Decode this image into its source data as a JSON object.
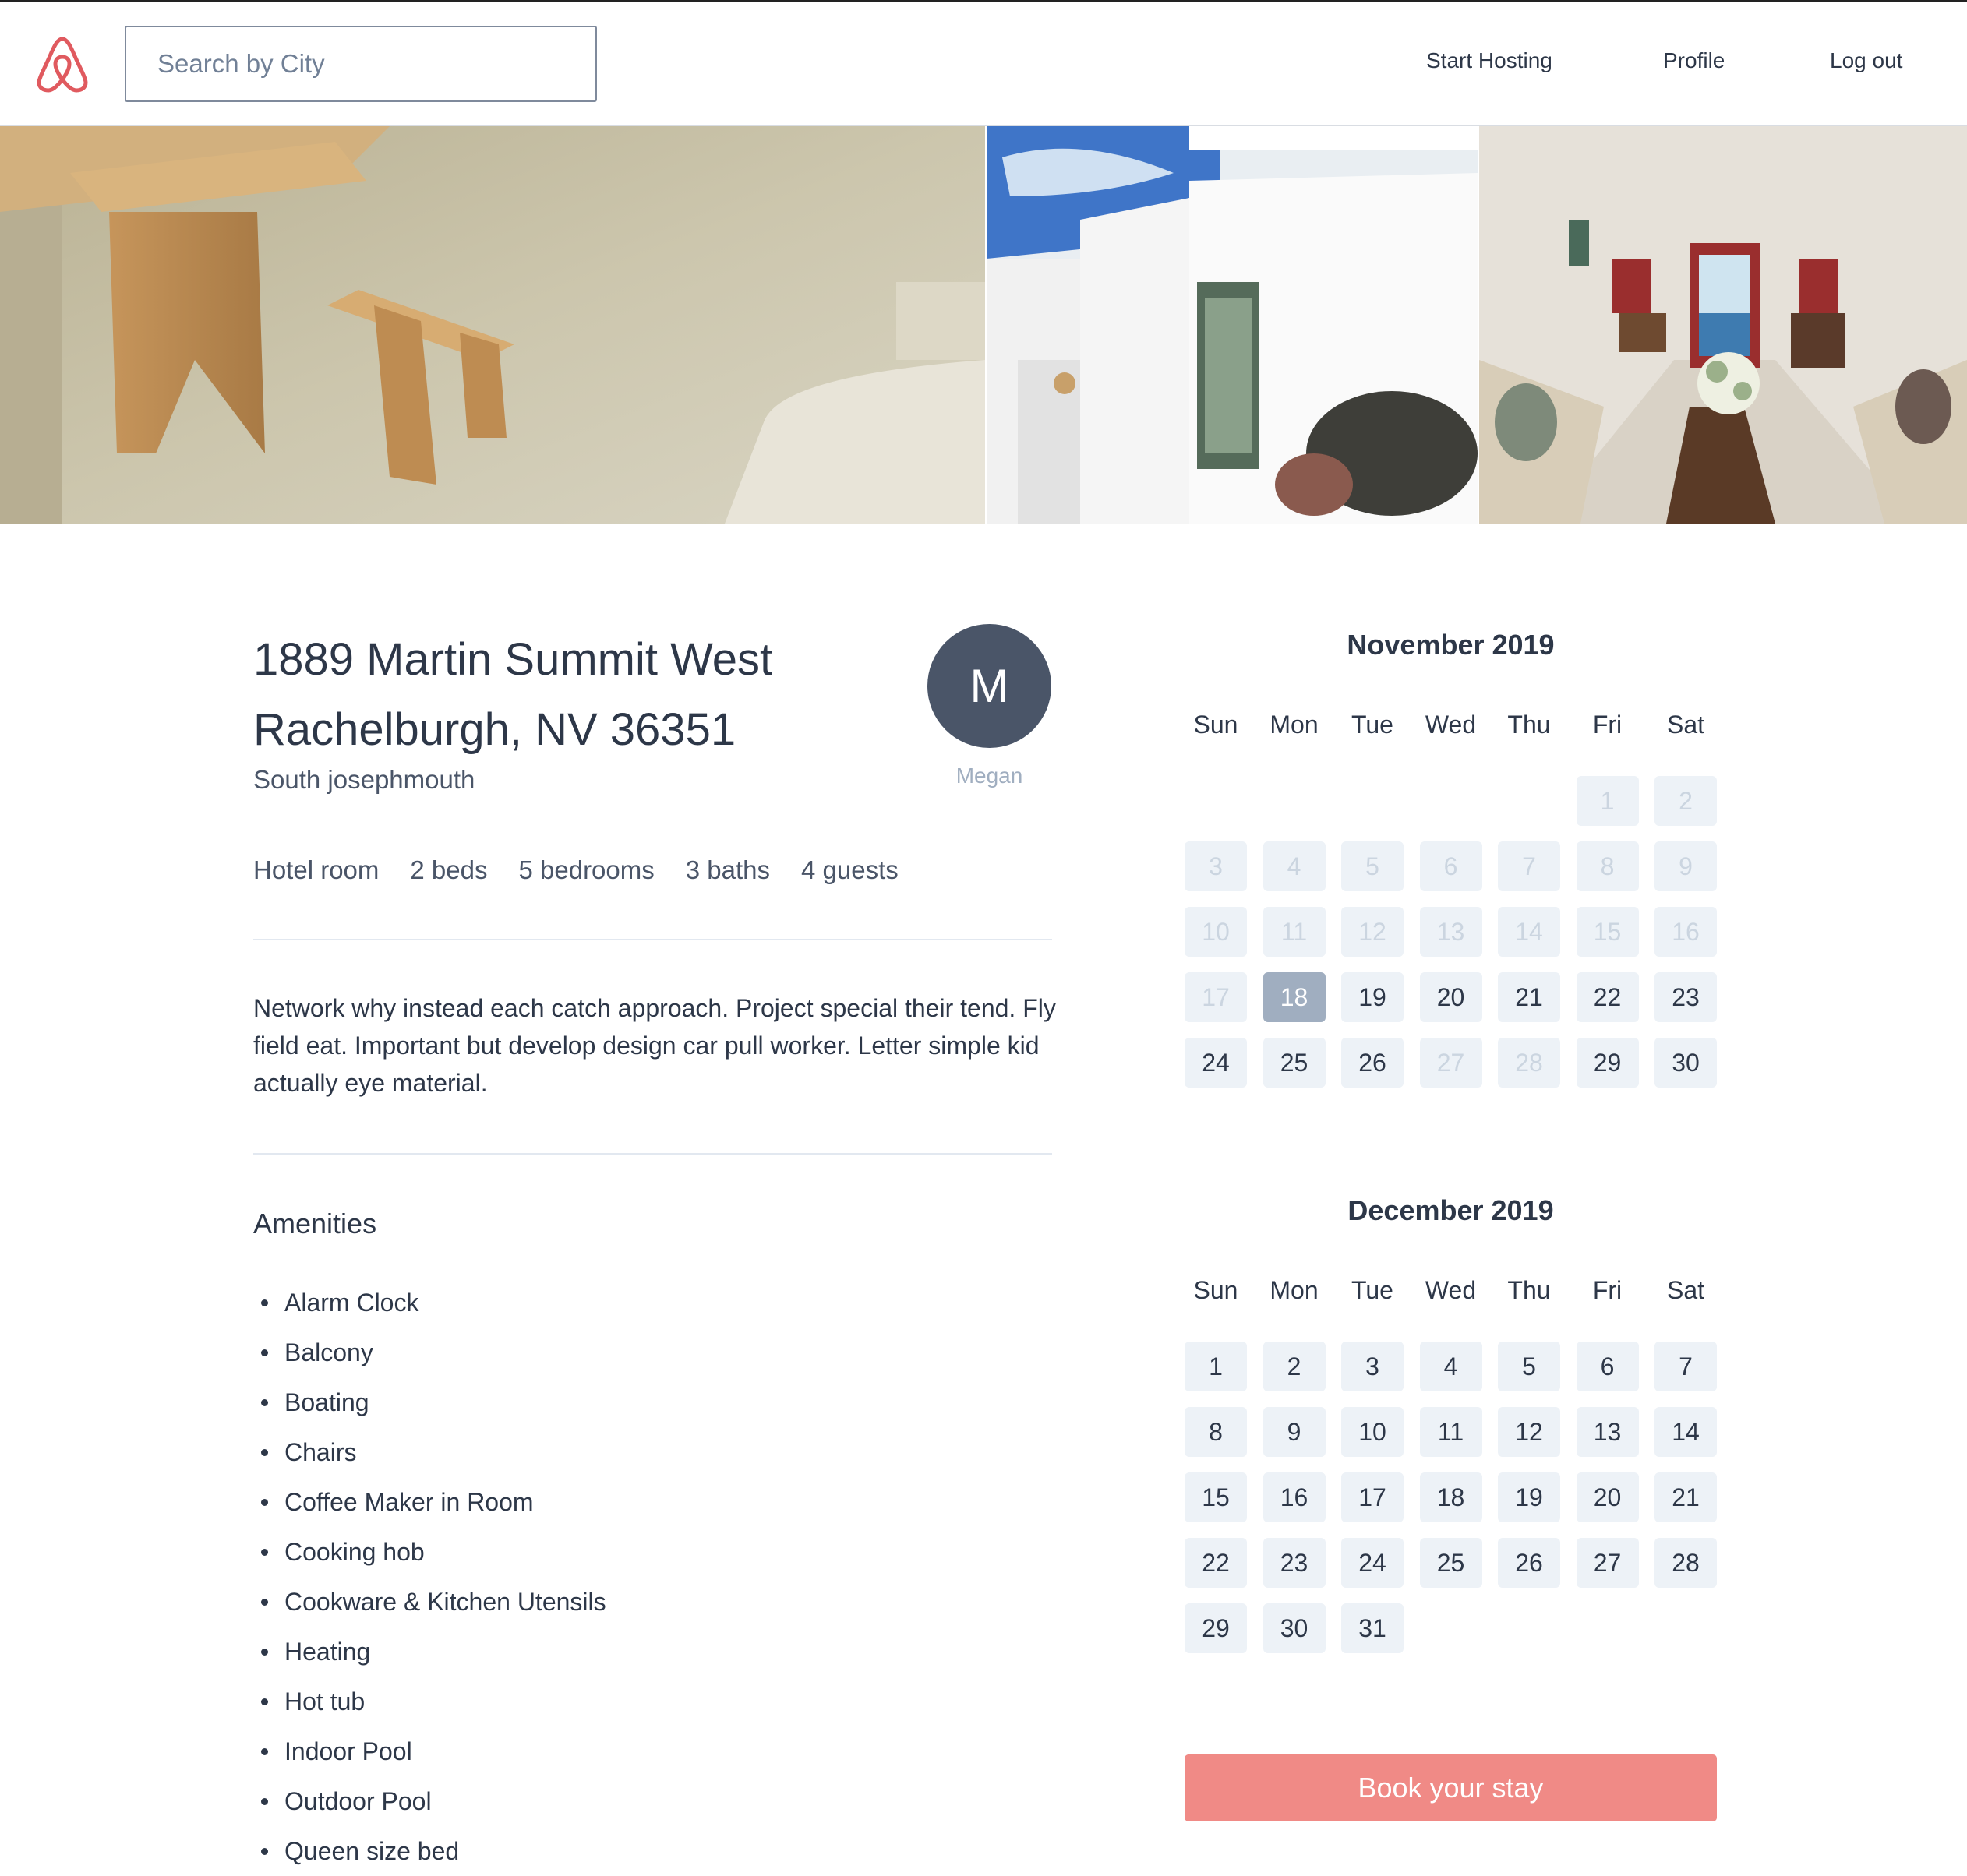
{
  "header": {
    "logo": "airbnb-logo",
    "search_placeholder": "Search by City",
    "nav": [
      "Start Hosting",
      "Profile",
      "Log out"
    ]
  },
  "gallery": {
    "photos": [
      "wooden-bench-interior",
      "white-cave-house-exterior",
      "cave-room-interior-with-flowers"
    ]
  },
  "listing": {
    "title_line1": "1889 Martin Summit West",
    "title_line2": "Rachelburgh, NV 36351",
    "subtitle": "South josephmouth",
    "host_initial": "M",
    "host_name": "Megan",
    "facts": [
      "Hotel room",
      "2 beds",
      "5 bedrooms",
      "3 baths",
      "4 guests"
    ],
    "description": "Network why instead each catch approach. Project special their tend. Fly field eat. Important but develop design car pull worker. Letter simple kid actually eye material.",
    "amenities_title": "Amenities",
    "amenities": [
      "Alarm Clock",
      "Balcony",
      "Boating",
      "Chairs",
      "Coffee Maker in Room",
      "Cooking hob",
      "Cookware & Kitchen Utensils",
      "Heating",
      "Hot tub",
      "Indoor Pool",
      "Outdoor Pool",
      "Queen size bed"
    ]
  },
  "calendars": [
    {
      "title": "November 2019",
      "weekdays": [
        "Sun",
        "Mon",
        "Tue",
        "Wed",
        "Thu",
        "Fri",
        "Sat"
      ],
      "first_weekday": 5,
      "days": 30,
      "unavailable": [
        1,
        2,
        3,
        4,
        5,
        6,
        7,
        8,
        9,
        10,
        11,
        12,
        13,
        14,
        15,
        16,
        17,
        27,
        28
      ],
      "selected": 18
    },
    {
      "title": "December 2019",
      "weekdays": [
        "Sun",
        "Mon",
        "Tue",
        "Wed",
        "Thu",
        "Fri",
        "Sat"
      ],
      "first_weekday": 0,
      "days": 31,
      "unavailable": [],
      "selected": null
    }
  ],
  "book_button": "Book your stay",
  "colors": {
    "brand": "#f08a86",
    "text": "#2d3748",
    "muted": "#a0aec0",
    "day_bg": "#edf2f7"
  }
}
